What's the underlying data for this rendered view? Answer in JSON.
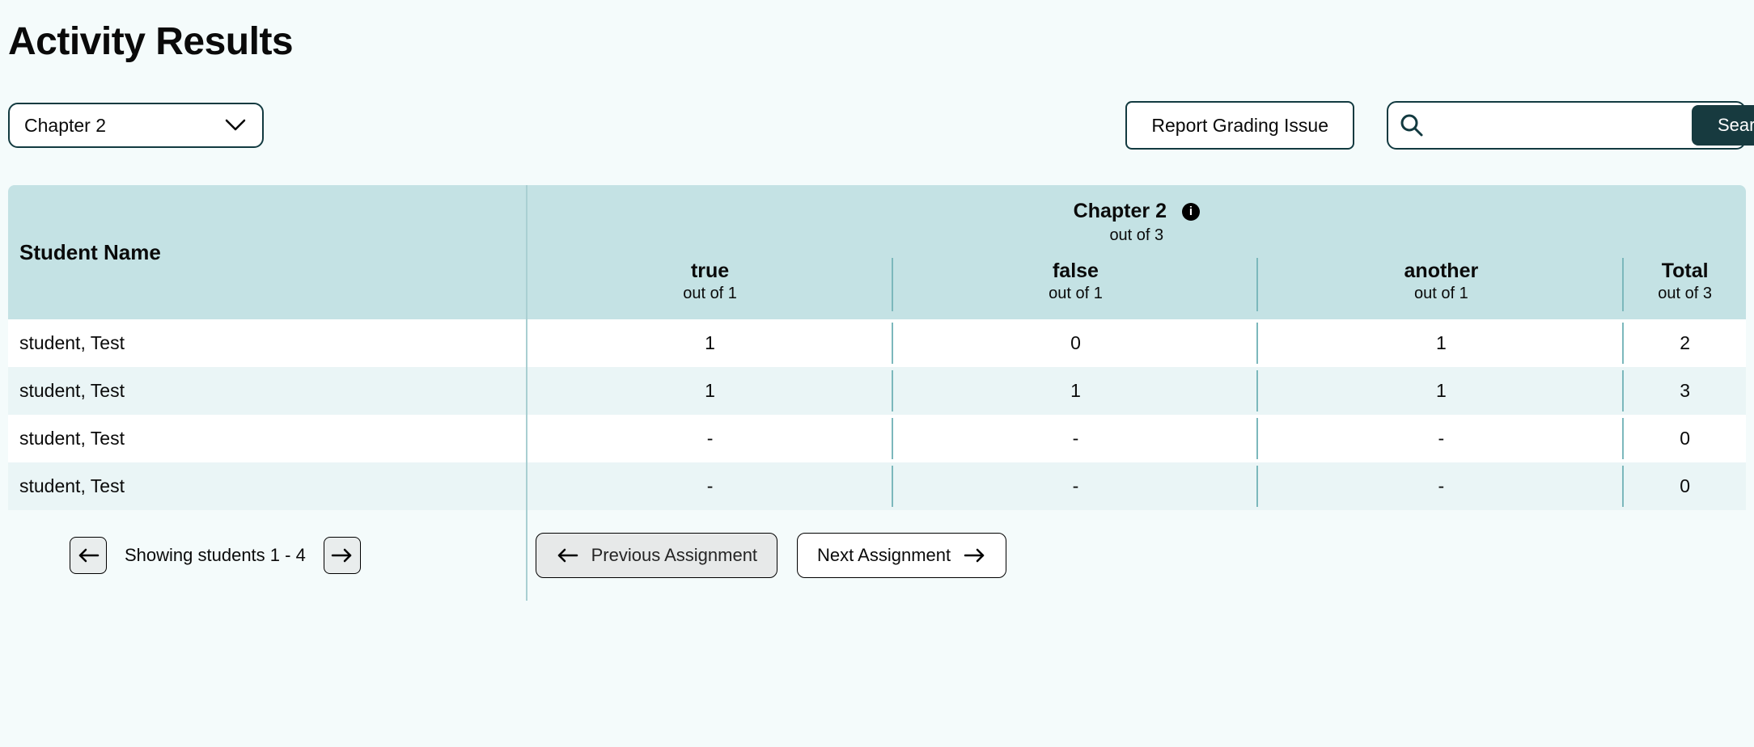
{
  "page_title": "Activity Results",
  "chapter_select": {
    "selected": "Chapter 2"
  },
  "report_issue_label": "Report Grading Issue",
  "search": {
    "placeholder": "",
    "value": "",
    "button_label": "Search"
  },
  "table": {
    "chapter_header": "Chapter 2",
    "chapter_out_of": "out of 3",
    "name_column": "Student Name",
    "columns": [
      {
        "label": "true",
        "out_of": "out of 1"
      },
      {
        "label": "false",
        "out_of": "out of 1"
      },
      {
        "label": "another",
        "out_of": "out of 1"
      }
    ],
    "total_column": {
      "label": "Total",
      "out_of": "out of 3"
    },
    "rows": [
      {
        "name": "student, Test",
        "scores": [
          "1",
          "0",
          "1"
        ],
        "total": "2"
      },
      {
        "name": "student, Test",
        "scores": [
          "1",
          "1",
          "1"
        ],
        "total": "3"
      },
      {
        "name": "student, Test",
        "scores": [
          "-",
          "-",
          "-"
        ],
        "total": "0"
      },
      {
        "name": "student, Test",
        "scores": [
          "-",
          "-",
          "-"
        ],
        "total": "0"
      }
    ]
  },
  "pagination": {
    "showing_text": "Showing students 1 - 4",
    "prev_assignment": "Previous Assignment",
    "next_assignment": "Next Assignment"
  }
}
